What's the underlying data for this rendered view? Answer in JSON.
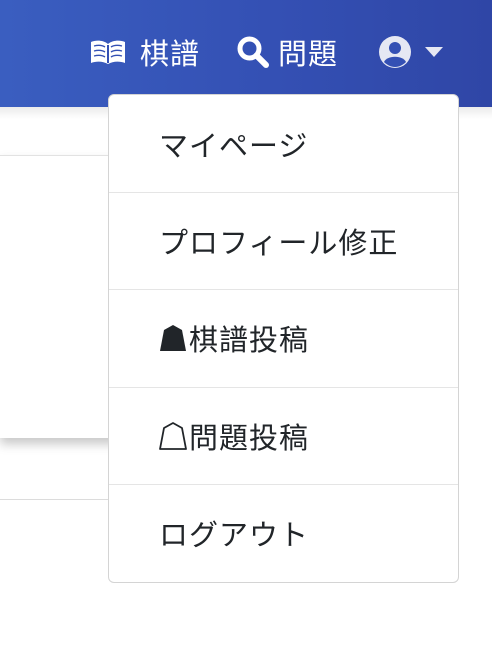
{
  "navbar": {
    "kifu_label": "棋譜",
    "mondai_label": "問題",
    "icons": [
      "book-open-icon",
      "search-icon",
      "user-circle-icon",
      "caret-down-icon"
    ]
  },
  "dropdown": {
    "items": [
      {
        "label": "マイページ"
      },
      {
        "label": "プロフィール修正"
      },
      {
        "label": "棋譜投稿",
        "icon": "shogi-piece-filled-icon"
      },
      {
        "label": "問題投稿",
        "icon": "shogi-piece-outline-icon"
      },
      {
        "label": "ログアウト"
      }
    ]
  },
  "colors": {
    "navbar": "#3450b4",
    "text": "#212529",
    "nav_text": "#ffffff"
  }
}
